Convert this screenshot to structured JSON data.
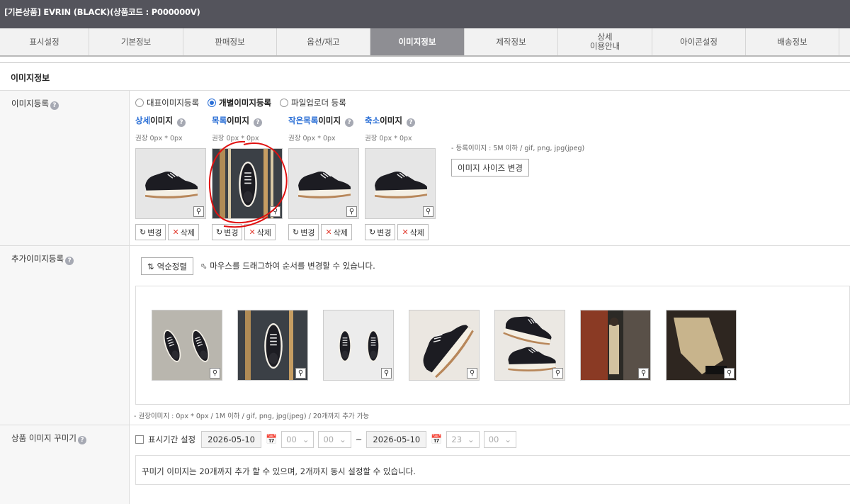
{
  "window_title": "[기본상품] EVRIN (BLACK)(상품코드 : P000000V)",
  "tabs": [
    {
      "label": "표시설정"
    },
    {
      "label": "기본정보"
    },
    {
      "label": "판매정보"
    },
    {
      "label": "옵션/재고"
    },
    {
      "label": "이미지정보",
      "active": true
    },
    {
      "label": "제작정보"
    },
    {
      "label": "상세\n이용안내"
    },
    {
      "label": "아이콘설정"
    },
    {
      "label": "배송정보"
    }
  ],
  "section_title": "이미지정보",
  "image_register": {
    "label": "이미지등록",
    "help": "?",
    "radios": [
      {
        "label": "대표이미지등록",
        "checked": false
      },
      {
        "label": "개별이미지등록",
        "checked": true
      },
      {
        "label": "파일업로더 등록",
        "checked": false
      }
    ],
    "images": [
      {
        "blue": "상세",
        "rest": "이미지",
        "rec": "권장 0px * 0px"
      },
      {
        "blue": "목록",
        "rest": "이미지",
        "rec": "권장 0px * 0px"
      },
      {
        "blue": "작은목록",
        "rest": "이미지",
        "rec": "권장 0px * 0px"
      },
      {
        "blue": "축소",
        "rest": "이미지",
        "rec": "권장 0px * 0px"
      }
    ],
    "change_label": "변경",
    "delete_label": "삭제",
    "note": "- 등록이미지 : 5M 이하 / gif, png, jpg(jpeg)",
    "size_change_button": "이미지 사이즈 변경"
  },
  "additional_images": {
    "label": "추가이미지등록",
    "reverse_button": "역순정렬",
    "drag_hint": "마우스를 드래그하여 순서를 변경할 수 있습니다.",
    "count": 7,
    "note": "- 권장이미지 : 0px * 0px / 1M 이하 / gif, png, jpg(jpeg) / 20개까지 추가 가능"
  },
  "decoration": {
    "label": "상품 이미지 꾸미기",
    "period_label": "표시기간 설정",
    "start_date": "2026-05-10",
    "start_hour": "00",
    "start_min": "00",
    "tilde": "~",
    "end_date": "2026-05-10",
    "end_hour": "23",
    "end_min": "00",
    "info": "꾸미기 이미지는 20개까지 추가 할 수 있으며, 2개까지 동시 설정할 수 있습니다."
  },
  "icons": {
    "zoom": "magnifier-icon",
    "calendar": "calendar-icon",
    "refresh": "refresh-icon",
    "delete": "x-icon",
    "sort": "sort-icon",
    "cursor": "cursor-icon"
  },
  "colors": {
    "accent": "#2b6fd6",
    "delete": "#e23b2f",
    "active_tab": "#8e8e93",
    "title_bar": "#54545c",
    "annotation": "#e01010"
  }
}
